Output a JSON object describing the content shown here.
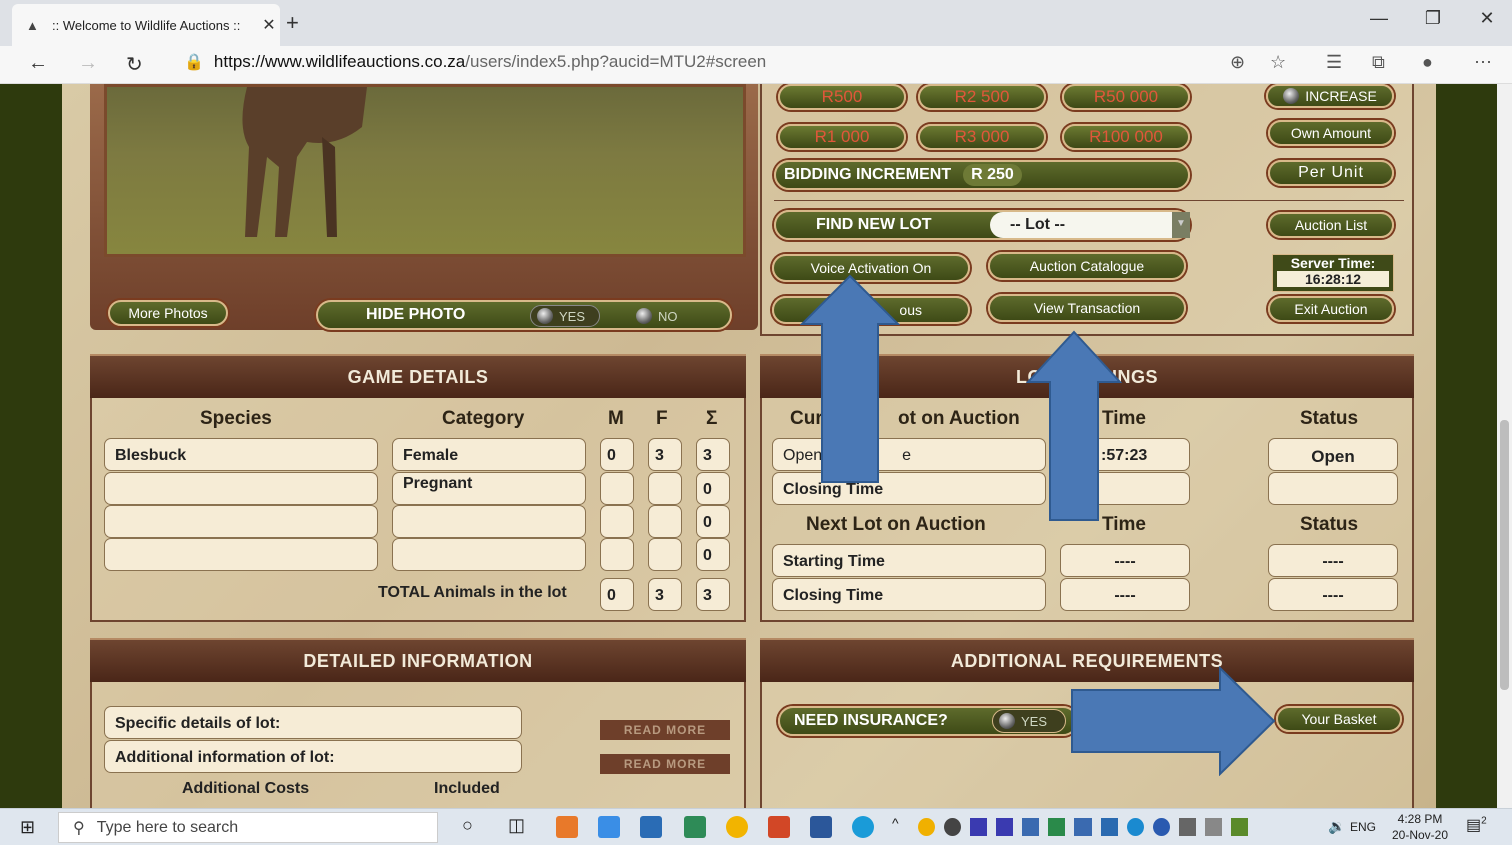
{
  "browser": {
    "tab_title": ":: Welcome to Wildlife Auctions ::",
    "url_domain": "https://www.wildlifeauctions.co.za",
    "url_path": "/users/index5.php?aucid=MTU2#screen"
  },
  "bidding": {
    "amounts_row1": [
      "R500",
      "R2 500",
      "R50 000"
    ],
    "amounts_row2": [
      "R1 000",
      "R3 000",
      "R100 000"
    ],
    "increase_label": "INCREASE",
    "own_amount_label": "Own Amount",
    "per_unit_label": "Per Unit",
    "increment_label": "BIDDING INCREMENT",
    "increment_value": "R 250",
    "find_new_lot_label": "FIND NEW LOT",
    "lot_select_value": "-- Lot --",
    "auction_list_label": "Auction List",
    "voice_activation_label": "Voice Activation On",
    "auction_catalogue_label": "Auction Catalogue",
    "server_time_label": "Server Time:",
    "server_time_value": "16:28:12",
    "previous_label": "ous",
    "view_transaction_label": "View Transaction",
    "exit_auction_label": "Exit Auction"
  },
  "photo": {
    "more_photos_label": "More Photos",
    "hide_photo_label": "HIDE PHOTO",
    "yes_label": "YES",
    "no_label": "NO"
  },
  "game_details": {
    "title": "GAME DETAILS",
    "headers": [
      "Species",
      "Category",
      "M",
      "F",
      "Σ"
    ],
    "rows": [
      {
        "species": "Blesbuck",
        "category": "Female",
        "m": "0",
        "f": "3",
        "sum": "3"
      },
      {
        "species": "",
        "category": "Pregnant",
        "m": "",
        "f": "",
        "sum": "0"
      },
      {
        "species": "",
        "category": "",
        "m": "",
        "f": "",
        "sum": "0"
      },
      {
        "species": "",
        "category": "",
        "m": "",
        "f": "",
        "sum": "0"
      }
    ],
    "total_label": "TOTAL Animals in the lot",
    "total_m": "0",
    "total_f": "3",
    "total_sum": "3"
  },
  "lot_timings": {
    "title_left": "LO",
    "title_right": "INGS",
    "current_header_left": "Cur",
    "current_header_right": "ot on Auction",
    "time_header": "Time",
    "status_header": "Status",
    "opening_label": "Open",
    "opening_suffix": "e",
    "opening_time": ":57:23",
    "current_status": "Open",
    "closing_label": "Closing Time",
    "closing_time": "",
    "next_header": "Next Lot on Auction",
    "starting_label": "Starting Time",
    "starting_time": "----",
    "starting_status": "----",
    "next_closing_label": "Closing Time",
    "next_closing_time": "----",
    "next_closing_status": "----"
  },
  "detailed_info": {
    "title": "DETAILED INFORMATION",
    "specific_label": "Specific details of lot:",
    "additional_label": "Additional information of lot:",
    "read_more_label": "READ MORE",
    "costs_label": "Additional Costs",
    "included_label": "Included"
  },
  "additional_requirements": {
    "title": "ADDITIONAL REQUIREMENTS",
    "insurance_label": "NEED INSURANCE?",
    "yes_label": "YES",
    "basket_label": "Your Basket"
  },
  "taskbar": {
    "search_placeholder": "Type here to search",
    "language": "ENG",
    "time": "4:28 PM",
    "date": "20-Nov-20",
    "notification_count": "2"
  },
  "colors": {
    "arrow_fill": "#4a78b5",
    "header_brown": "#5a3220",
    "pill_olive": "#4c5820"
  }
}
